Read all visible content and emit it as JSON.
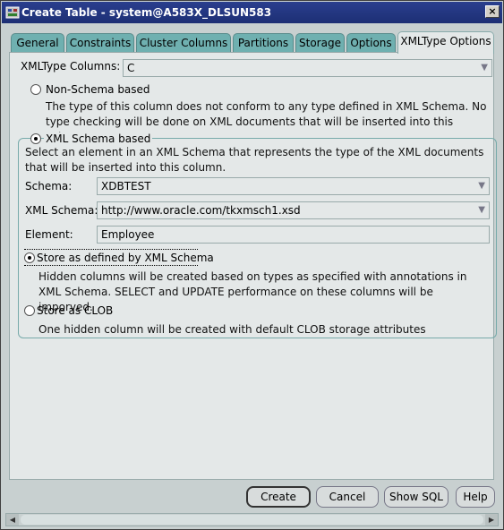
{
  "window": {
    "title": "Create Table - system@A583X_DLSUN583",
    "close_glyph": "×"
  },
  "tabs": [
    {
      "label": "General"
    },
    {
      "label": "Constraints"
    },
    {
      "label": "Cluster Columns"
    },
    {
      "label": "Partitions"
    },
    {
      "label": "Storage"
    },
    {
      "label": "Options"
    },
    {
      "label": "XMLType Options"
    }
  ],
  "active_tab": "XMLType Options",
  "xmltype_columns": {
    "label": "XMLType Columns:",
    "value": "C"
  },
  "non_schema": {
    "label": "Non-Schema based",
    "selected": false,
    "description": "The type of this column does not conform to any type defined in XML Schema. No type checking will be done on XML documents that will be inserted into this column."
  },
  "schema_based": {
    "label": "XML Schema based",
    "selected": true,
    "instruction": "Select an element in an XML Schema that represents the type of the XML documents that will be inserted into this column.",
    "schema_label": "Schema:",
    "schema_value": "XDBTEST",
    "xml_schema_label": "XML Schema:",
    "xml_schema_value": "http://www.oracle.com/tkxmsch1.xsd",
    "element_label": "Element:",
    "element_value": "Employee",
    "store_schema": {
      "label": "Store as defined by XML Schema",
      "selected": true,
      "description": "Hidden columns will be created based on types as specified with annotations in XML Schema. SELECT and UPDATE performance on these columns will be imporved."
    },
    "store_clob": {
      "label": "Store as CLOB",
      "selected": false,
      "description": "One hidden column will be created with default CLOB storage attributes"
    }
  },
  "buttons": {
    "create": "Create",
    "cancel": "Cancel",
    "show_sql": "Show SQL",
    "help": "Help"
  },
  "dropdown_glyph": "▼",
  "scroll_left_glyph": "◀",
  "scroll_right_glyph": "▶"
}
